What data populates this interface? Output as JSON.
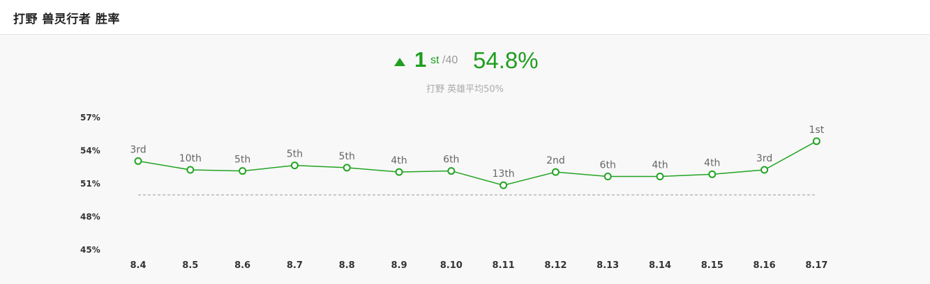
{
  "header": {
    "title": "打野 兽灵行者 胜率"
  },
  "summary": {
    "rank": "1",
    "rank_suffix": "st",
    "rank_total": "/40",
    "win_rate": "54.8%",
    "subtitle": "打野 英雄平均50%",
    "trend": "up"
  },
  "colors": {
    "accent": "#1f9e1f",
    "line": "#22a322",
    "average_line": "#999999",
    "label": "#666666",
    "axis_label": "#333333"
  },
  "chart_data": {
    "type": "line",
    "title": "",
    "xlabel": "",
    "ylabel": "",
    "categories": [
      "8.4",
      "8.5",
      "8.6",
      "8.7",
      "8.8",
      "8.9",
      "8.10",
      "8.11",
      "8.12",
      "8.13",
      "8.14",
      "8.15",
      "8.16",
      "8.17"
    ],
    "yticks": [
      "57%",
      "54%",
      "51%",
      "48%",
      "45%"
    ],
    "ytick_values": [
      57,
      54,
      51,
      48,
      45
    ],
    "ylim": [
      45,
      57
    ],
    "grid": false,
    "average": 50,
    "series": [
      {
        "values": [
          53.0,
          52.2,
          52.1,
          52.6,
          52.4,
          52.0,
          52.1,
          50.8,
          52.0,
          51.6,
          51.6,
          51.8,
          52.2,
          54.8
        ],
        "rank_labels": [
          "3rd",
          "10th",
          "5th",
          "5th",
          "5th",
          "4th",
          "6th",
          "13th",
          "2nd",
          "6th",
          "4th",
          "4th",
          "3rd",
          "1st"
        ]
      }
    ]
  }
}
